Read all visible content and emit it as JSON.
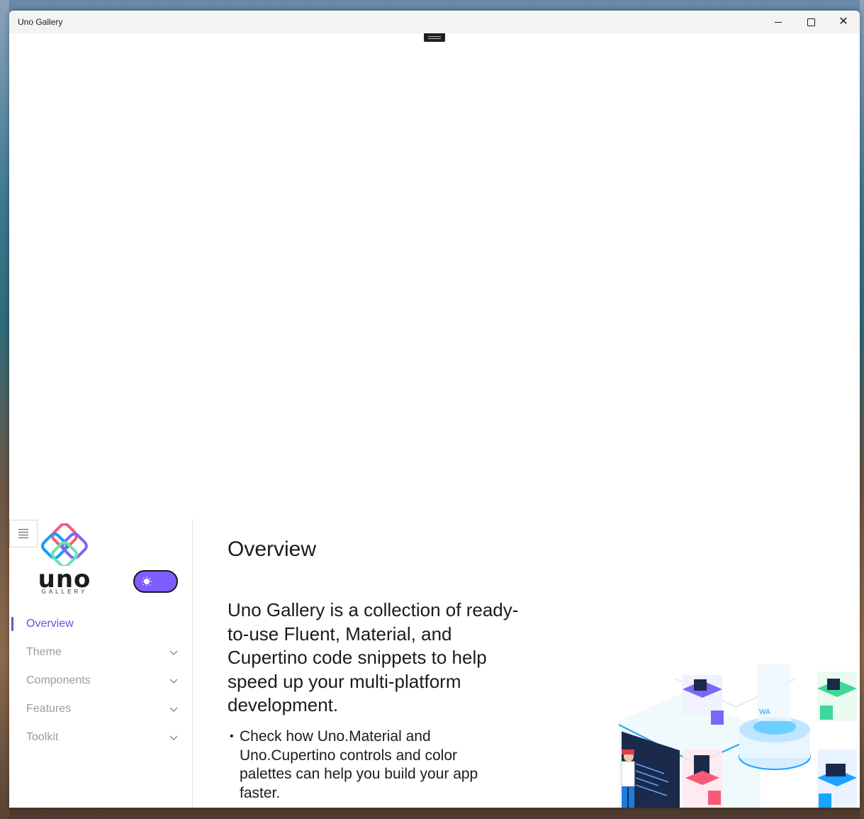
{
  "window": {
    "title": "Uno Gallery"
  },
  "titlebar": {
    "minimize_icon": "minimize-icon",
    "maximize_icon": "maximize-icon",
    "close_icon": "close-icon",
    "close_glyph": "✕"
  },
  "sidebar": {
    "logo_word": "uno",
    "logo_sub": "GALLERY",
    "theme_toggle": {
      "state": "light",
      "icon": "sun-icon",
      "color": "#7f5cff"
    },
    "items": [
      {
        "label": "Overview",
        "active": true,
        "expandable": false
      },
      {
        "label": "Theme",
        "active": false,
        "expandable": true
      },
      {
        "label": "Components",
        "active": false,
        "expandable": true
      },
      {
        "label": "Features",
        "active": false,
        "expandable": true
      },
      {
        "label": "Toolkit",
        "active": false,
        "expandable": true
      }
    ]
  },
  "main": {
    "title": "Overview",
    "lead": "Uno Gallery is a collection of ready-to-use Fluent, Material, and Cupertino code snippets to help speed up your multi-platform development.",
    "bullets": [
      "Check how Uno.Material and Uno.Cupertino controls and color palettes can help you build your app faster."
    ],
    "illustration_label": "WA"
  },
  "colors": {
    "accent": "#6b4fd8",
    "toggle": "#7f5cff",
    "muted_text": "#9b9b9b"
  }
}
